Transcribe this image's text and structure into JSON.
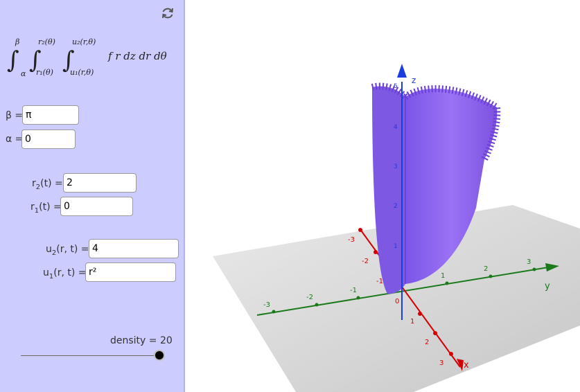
{
  "toolbar": {
    "refresh_icon": "refresh-icon"
  },
  "formula": {
    "upper_beta": "β",
    "lower_alpha": "α",
    "r_upper": "r₂(θ)",
    "r_lower": "r₁(θ)",
    "u_upper": "u₂(r,θ)",
    "u_lower": "u₁(r,θ)",
    "integrand": "f r dz dr dθ"
  },
  "inputs": {
    "beta": {
      "label": "β =",
      "value": "π"
    },
    "alpha": {
      "label": "α =",
      "value": "0"
    },
    "r2": {
      "label_main": "r",
      "label_sub": "2",
      "label_rest": "(t) =",
      "value": "2"
    },
    "r1": {
      "label_main": "r",
      "label_sub": "1",
      "label_rest": "(t) =",
      "value": "0"
    },
    "u2": {
      "label_main": "u",
      "label_sub": "2",
      "label_rest": "(r, t) =",
      "value": "4"
    },
    "u1": {
      "label_main": "u",
      "label_sub": "1",
      "label_rest": "(r, t) =",
      "value": "r²"
    }
  },
  "slider": {
    "label": "density = 20",
    "value": 20
  },
  "graph3d": {
    "colors": {
      "solid": "#8a5cf0",
      "x_axis": "#d40000",
      "y_axis": "#1a7a1a",
      "z_axis": "#1a3de0",
      "plane": "#cfcfcf"
    },
    "x_ticks": [
      "-3",
      "-2",
      "-1",
      "0",
      "1",
      "2",
      "3"
    ],
    "y_ticks": [
      "-3",
      "-2",
      "-1",
      "0",
      "1",
      "2",
      "3"
    ],
    "z_ticks": [
      "1",
      "2",
      "3",
      "4",
      "5"
    ],
    "x_label": "x",
    "y_label": "y",
    "z_label": "z"
  }
}
